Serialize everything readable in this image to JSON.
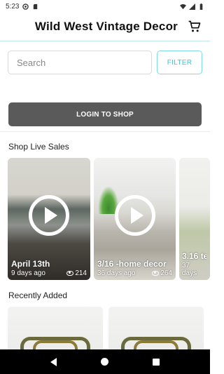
{
  "status": {
    "time": "5:23"
  },
  "header": {
    "title": "Wild West Vintage Decor",
    "cart_icon": "cart-icon"
  },
  "search": {
    "placeholder": "Search",
    "filter_label": "FILTER"
  },
  "login": {
    "label": "LOGIN TO SHOP"
  },
  "live": {
    "title": "Shop Live Sales",
    "cards": [
      {
        "name": "April 13th",
        "age": "9 days ago",
        "views": "214"
      },
      {
        "name": "3/16 -home decor",
        "age": "36 days ago",
        "views": "264"
      },
      {
        "name": "3.16 te",
        "age": "37 days"
      }
    ]
  },
  "recent": {
    "title": "Recently Added"
  },
  "colors": {
    "accent": "#3fc5d1",
    "button": "#5a5a5a"
  }
}
